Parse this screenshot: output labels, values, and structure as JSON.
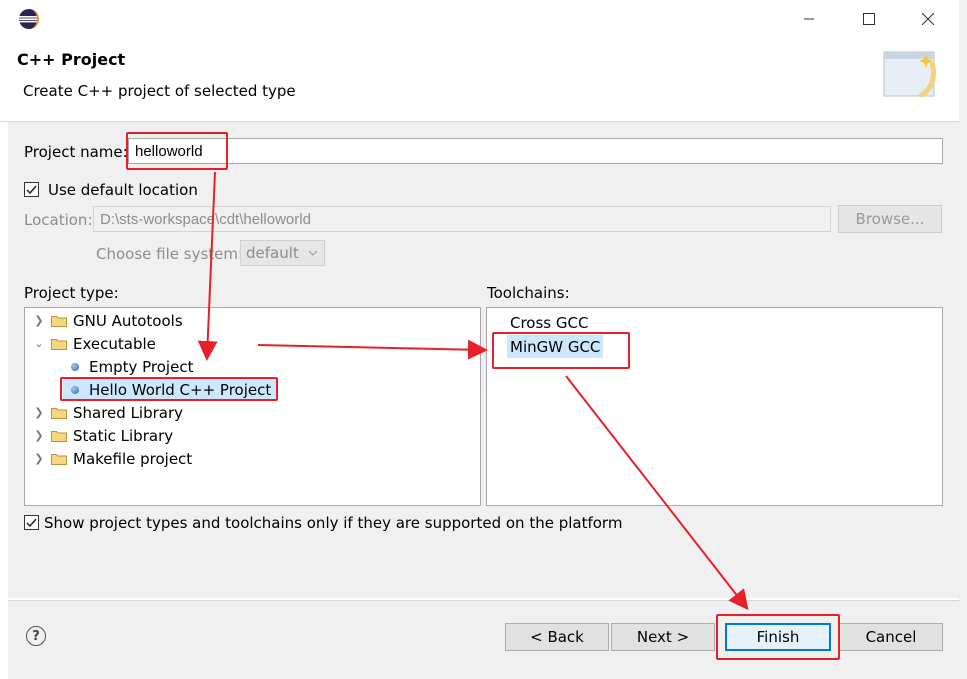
{
  "dialog": {
    "header_title": "C++ Project",
    "header_subtitle": "Create C++ project of selected type"
  },
  "form": {
    "project_name_label": "Project name:",
    "project_name_value": "helloworld",
    "use_default_location_label": "Use default location",
    "use_default_location_checked": true,
    "location_label": "Location:",
    "location_value": "D:\\sts-workspace\\cdt\\helloworld",
    "browse_label": "Browse...",
    "file_system_label": "Choose file system:",
    "file_system_value": "default"
  },
  "project_type": {
    "label": "Project type:",
    "items": [
      {
        "label": "GNU Autotools",
        "kind": "folder",
        "expanded": false
      },
      {
        "label": "Executable",
        "kind": "folder",
        "expanded": true
      },
      {
        "label": "Empty Project",
        "kind": "leaf"
      },
      {
        "label": "Hello World C++ Project",
        "kind": "leaf",
        "selected": true
      },
      {
        "label": "Shared Library",
        "kind": "folder",
        "expanded": false
      },
      {
        "label": "Static Library",
        "kind": "folder",
        "expanded": false
      },
      {
        "label": "Makefile project",
        "kind": "folder",
        "expanded": false
      }
    ]
  },
  "toolchains": {
    "label": "Toolchains:",
    "items": [
      {
        "label": "Cross GCC"
      },
      {
        "label": "MinGW GCC",
        "selected": true
      }
    ]
  },
  "show_supported": {
    "label": "Show project types and toolchains only if they are supported on the platform",
    "checked": true
  },
  "buttons": {
    "back": "< Back",
    "next": "Next >",
    "finish": "Finish",
    "cancel": "Cancel"
  },
  "colors": {
    "annotation": "#e8202a",
    "selection": "#cce8ff",
    "dialog_bg": "#f0f0f0"
  }
}
